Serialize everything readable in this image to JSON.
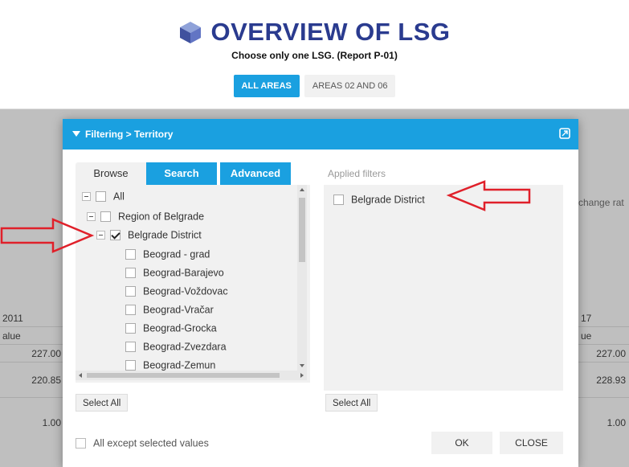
{
  "page": {
    "title": "OVERVIEW OF LSG",
    "subtitle": "Choose only one LSG. (Report P-01)",
    "area_tabs": [
      {
        "label": "ALL AREAS",
        "active": true
      },
      {
        "label": "AREAS 02 AND 06",
        "active": false
      }
    ],
    "background_table": {
      "left": {
        "year": "2011",
        "header": "alue",
        "values": [
          "227.00",
          "220.85",
          "1.00"
        ]
      },
      "right": {
        "year": "17",
        "header": "ue",
        "values": [
          "227.00",
          "228.93",
          "1.00"
        ]
      },
      "change_label": "change rat"
    }
  },
  "dialog": {
    "title": "Filtering > Territory",
    "tabs": [
      "Browse",
      "Search",
      "Advanced"
    ],
    "tree": [
      {
        "label": "All",
        "level": 0,
        "checked": false,
        "expander": true
      },
      {
        "label": "Region of Belgrade",
        "level": 1,
        "checked": false,
        "expander": true
      },
      {
        "label": "Belgrade District",
        "level": 2,
        "checked": true,
        "expander": true
      },
      {
        "label": "Beograd - grad",
        "level": 3,
        "checked": false
      },
      {
        "label": "Beograd-Barajevo",
        "level": 3,
        "checked": false
      },
      {
        "label": "Beograd-Voždovac",
        "level": 3,
        "checked": false
      },
      {
        "label": "Beograd-Vračar",
        "level": 3,
        "checked": false
      },
      {
        "label": "Beograd-Grocka",
        "level": 3,
        "checked": false
      },
      {
        "label": "Beograd-Zvezdara",
        "level": 3,
        "checked": false
      },
      {
        "label": "Beograd-Zemun",
        "level": 3,
        "checked": false
      }
    ],
    "applied_filters_label": "Applied filters",
    "applied_filters": [
      {
        "label": "Belgrade District",
        "checked": false
      }
    ],
    "select_all_label": "Select All",
    "except_label": "All except selected values",
    "ok_label": "OK",
    "close_label": "CLOSE"
  },
  "colors": {
    "accent": "#1aa0e0",
    "title": "#2a3b8f",
    "annotation": "#e0202a"
  }
}
